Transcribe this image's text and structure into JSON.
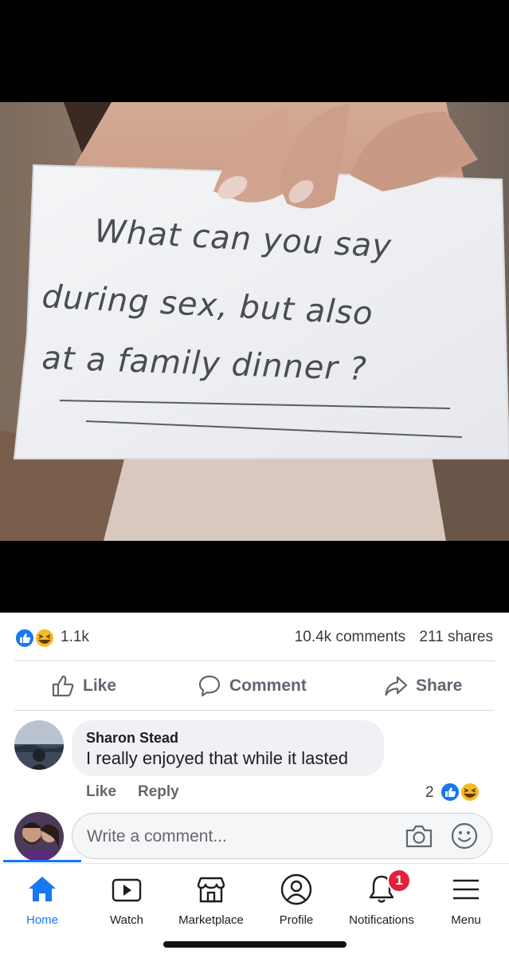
{
  "photo": {
    "note_lines": [
      "What can you say",
      "during sex, but also",
      "at a family dinner ?"
    ]
  },
  "reactions": {
    "icons": [
      "like-reaction-icon",
      "haha-reaction-icon"
    ],
    "count": "1.1k",
    "comments": "10.4k comments",
    "shares": "211 shares"
  },
  "actions": {
    "like": "Like",
    "comment": "Comment",
    "share": "Share"
  },
  "comment": {
    "author": "Sharon Stead",
    "text": "I really enjoyed that while it lasted",
    "like": "Like",
    "reply": "Reply",
    "reaction_count": "2"
  },
  "composer": {
    "placeholder": "Write a comment..."
  },
  "nav": {
    "home": "Home",
    "watch": "Watch",
    "marketplace": "Marketplace",
    "profile": "Profile",
    "notifications": "Notifications",
    "notifications_badge": "1",
    "menu": "Menu"
  },
  "colors": {
    "accent": "#1877f2",
    "badge": "#e41e3f",
    "haha": "#f7b928"
  }
}
